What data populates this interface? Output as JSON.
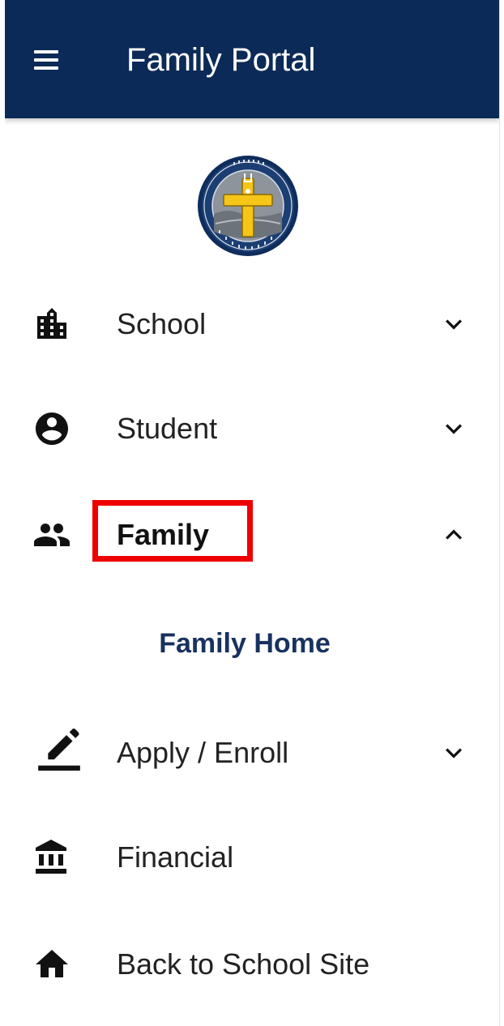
{
  "header": {
    "title": "Family Portal",
    "menu_icon": "menu-icon",
    "background": "#0b2a57"
  },
  "logo": {
    "alt": "school-crest-logo"
  },
  "nav": {
    "school": {
      "label": "School",
      "icon": "city-icon",
      "state": "collapsed"
    },
    "student": {
      "label": "Student",
      "icon": "account-circle-icon",
      "state": "collapsed"
    },
    "family": {
      "label": "Family",
      "icon": "people-icon",
      "state": "expanded",
      "children": [
        {
          "label": "Family Home"
        }
      ]
    },
    "apply": {
      "label": "Apply / Enroll",
      "icon": "edit-icon",
      "state": "collapsed"
    },
    "financial": {
      "label": "Financial",
      "icon": "bank-icon"
    },
    "back": {
      "label": "Back to School Site",
      "icon": "home-icon"
    }
  },
  "colors": {
    "accent": "#17325e",
    "highlight": "#ee0000"
  }
}
